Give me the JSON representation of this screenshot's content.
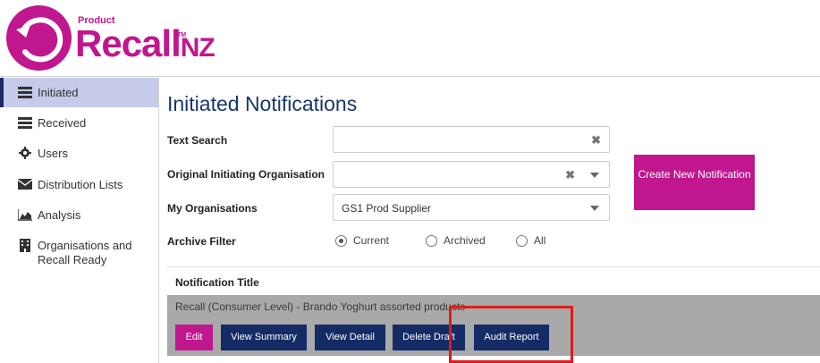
{
  "brand": {
    "small": "Product",
    "main": "Recall",
    "suffix": "NZ",
    "tm": "TM",
    "color": "#c0168e"
  },
  "sidebar": {
    "items": [
      {
        "label": "Initiated",
        "icon": "list-icon"
      },
      {
        "label": "Received",
        "icon": "list-icon"
      },
      {
        "label": "Users",
        "icon": "gear-icon"
      },
      {
        "label": "Distribution Lists",
        "icon": "envelope-icon"
      },
      {
        "label": "Analysis",
        "icon": "area-chart-icon"
      },
      {
        "label": "Organisations and Recall Ready",
        "icon": "building-icon"
      }
    ]
  },
  "main": {
    "title": "Initiated Notifications",
    "text_search": {
      "label": "Text Search",
      "value": ""
    },
    "original_org": {
      "label": "Original Initiating Organisation",
      "value": ""
    },
    "my_orgs": {
      "label": "My Organisations",
      "value": "GS1 Prod Supplier"
    },
    "archive": {
      "label": "Archive Filter",
      "options": [
        "Current",
        "Archived",
        "All"
      ],
      "selected": "Current"
    },
    "create_button": "Create New Notification",
    "table": {
      "header": "Notification Title",
      "rows": [
        {
          "title": "Recall (Consumer Level) - Brando Yoghurt assorted products",
          "buttons": [
            "Edit",
            "View Summary",
            "View Detail",
            "Delete Draft",
            "Audit Report"
          ]
        }
      ]
    }
  },
  "colors": {
    "accent": "#c0168e",
    "navy": "#142b66",
    "title": "#17376b",
    "sidebar_active": "#c5cbe9",
    "row_bg": "#a9a9a9",
    "highlight": "#e01b1b"
  }
}
